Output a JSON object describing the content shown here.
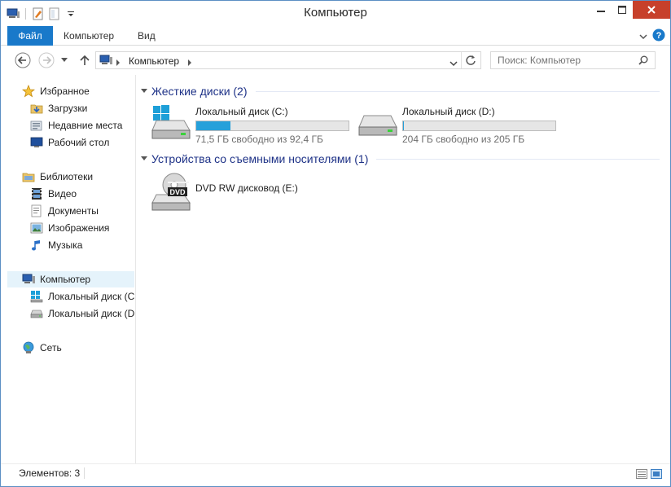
{
  "window": {
    "title": "Компьютер"
  },
  "ribbon": {
    "tabs": [
      {
        "label": "Файл"
      },
      {
        "label": "Компьютер"
      },
      {
        "label": "Вид"
      }
    ]
  },
  "address": {
    "breadcrumb": "Компьютер",
    "search_placeholder": "Поиск: Компьютер"
  },
  "nav": {
    "favorites": {
      "label": "Избранное",
      "items": [
        "Загрузки",
        "Недавние места",
        "Рабочий стол"
      ]
    },
    "libraries": {
      "label": "Библиотеки",
      "items": [
        "Видео",
        "Документы",
        "Изображения",
        "Музыка"
      ]
    },
    "computer": {
      "label": "Компьютер",
      "items": [
        "Локальный диск (C:)",
        "Локальный диск (D:)"
      ]
    },
    "network": {
      "label": "Сеть"
    }
  },
  "groups": {
    "hard_disks": {
      "title": "Жесткие диски (2)",
      "drives": [
        {
          "name": "Локальный диск (C:)",
          "free": "71,5 ГБ свободно из 92,4 ГБ",
          "used_fraction": 0.226
        },
        {
          "name": "Локальный диск (D:)",
          "free": "204 ГБ свободно из 205 ГБ",
          "used_fraction": 0.005
        }
      ]
    },
    "removable": {
      "title": "Устройства со съемными носителями (1)",
      "drives": [
        {
          "name": "DVD RW дисковод (E:)",
          "disc_label": "DVD"
        }
      ]
    }
  },
  "status": {
    "items_count": "Элементов: 3"
  },
  "colors": {
    "accent": "#1979ca",
    "usage_bar": "#26a0da",
    "group_title": "#1e3287",
    "close_button": "#c7402b"
  }
}
